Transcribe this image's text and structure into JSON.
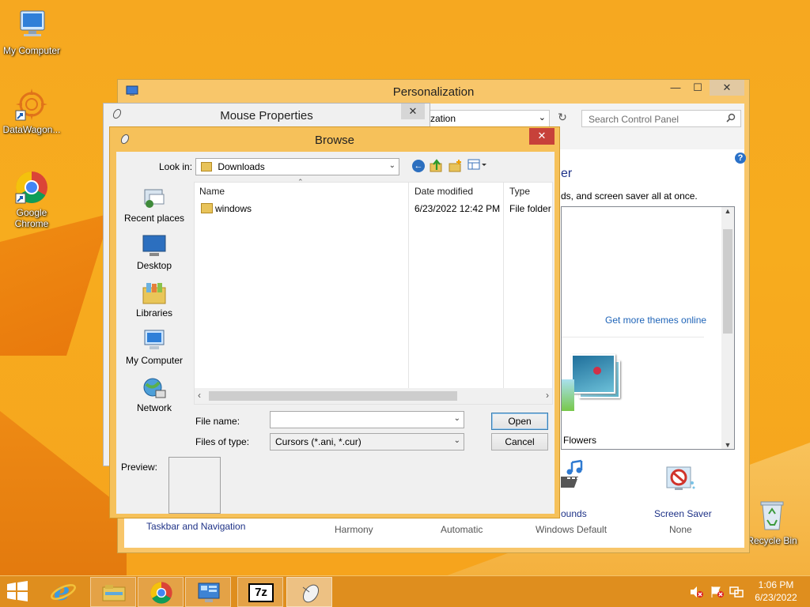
{
  "desktop": {
    "icons": [
      {
        "label": "My Computer",
        "icon": "my-computer-icon"
      },
      {
        "label": "DataWagon...",
        "icon": "datawagon-icon"
      },
      {
        "label": "Google Chrome",
        "icon": "chrome-icon"
      },
      {
        "label": "Recycle Bin",
        "icon": "recycle-bin-icon"
      }
    ]
  },
  "personalization": {
    "title": "Personalization",
    "address_fragment": "zation",
    "search_placeholder": "Search Control Panel",
    "heading_fragment": "er",
    "desc_fragment": "ds, and screen saver all at once.",
    "themes_link": "Get more themes online",
    "theme_flowers": "Flowers",
    "bottom": {
      "taskbar_nav": "Taskbar and Navigation",
      "harmony": "Harmony",
      "automatic": "Automatic",
      "sounds_fragment": "ounds",
      "sounds_value": "Windows Default",
      "screen_saver": "Screen Saver",
      "screen_saver_value": "None"
    }
  },
  "mouse_properties": {
    "title": "Mouse Properties"
  },
  "browse": {
    "title": "Browse",
    "look_in_label": "Look in:",
    "look_in_value": "Downloads",
    "places": [
      "Recent places",
      "Desktop",
      "Libraries",
      "My Computer",
      "Network"
    ],
    "columns": [
      "Name",
      "Date modified",
      "Type"
    ],
    "files": [
      {
        "name": "windows",
        "date": "6/23/2022 12:42 PM",
        "type": "File folder"
      }
    ],
    "file_name_label": "File name:",
    "file_name_value": "",
    "files_of_type_label": "Files of type:",
    "files_of_type_value": "Cursors (*.ani, *.cur)",
    "open_label": "Open",
    "cancel_label": "Cancel",
    "preview_label": "Preview:"
  },
  "taskbar": {
    "time": "1:06 PM",
    "date": "6/23/2022",
    "seven_zip": "7z"
  }
}
